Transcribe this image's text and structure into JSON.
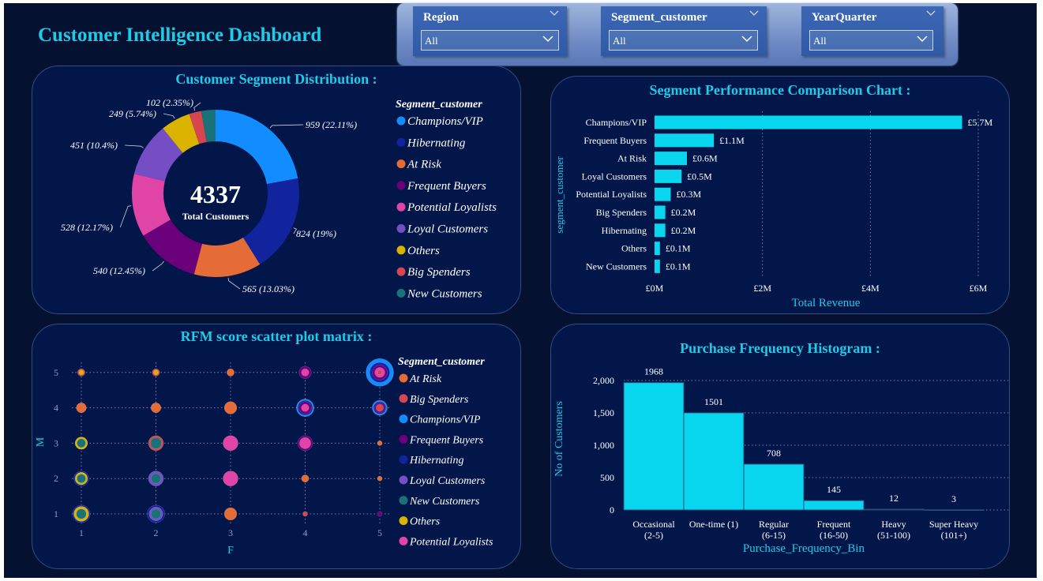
{
  "dashboard": {
    "title": "Customer Intelligence Dashboard"
  },
  "filters": [
    {
      "label": "Region",
      "value": "All"
    },
    {
      "label": "Segment_customer",
      "value": "All"
    },
    {
      "label": "YearQuarter",
      "value": "All"
    }
  ],
  "colors": {
    "Champions/VIP": "#118dff",
    "Hibernating": "#12239e",
    "At Risk": "#e66c37",
    "Frequent Buyers": "#6b007b",
    "Potential Loyalists": "#e044a7",
    "Loyal Customers": "#744ec2",
    "Others": "#d9b300",
    "Big Spenders": "#d64550",
    "New Customers": "#197278",
    "bars": "#08d6ee",
    "accent": "#1ecbe8"
  },
  "donut": {
    "title": "Customer Segment Distribution :",
    "center_value": "4337",
    "center_label": "Total Customers",
    "legend_title": "Segment_customer",
    "chart_data": {
      "type": "pie",
      "total": 4337,
      "slices": [
        {
          "name": "Champions/VIP",
          "value": 959,
          "label": "959 (22.11%)"
        },
        {
          "name": "Hibernating",
          "value": 824,
          "label": "824 (19%)"
        },
        {
          "name": "At Risk",
          "value": 565,
          "label": "565 (13.03%)"
        },
        {
          "name": "Frequent Buyers",
          "value": 540,
          "label": "540 (12.45%)"
        },
        {
          "name": "Potential Loyalists",
          "value": 528,
          "label": "528 (12.17%)"
        },
        {
          "name": "Loyal Customers",
          "value": 451,
          "label": "451 (10.4%)"
        },
        {
          "name": "Others",
          "value": 249,
          "label": "249 (5.74%)"
        },
        {
          "name": "Big Spenders",
          "value": 102,
          "label": "102 (2.35%)"
        },
        {
          "name": "New Customers",
          "value": 119,
          "label": ""
        }
      ]
    }
  },
  "bars": {
    "title": "Segment Performance Comparison Chart :",
    "chart_data": {
      "type": "bar",
      "orientation": "horizontal",
      "xlabel": "Total Revenue",
      "ylabel": "segment_customer",
      "xlim": [
        0,
        6
      ],
      "xticks": [
        0,
        2,
        4,
        6
      ],
      "xtick_labels": [
        "£0M",
        "£2M",
        "£4M",
        "£6M"
      ],
      "grid": true,
      "categories": [
        "Champions/VIP",
        "Frequent Buyers",
        "At Risk",
        "Loyal Customers",
        "Potential Loyalists",
        "Big Spenders",
        "Hibernating",
        "Others",
        "New Customers"
      ],
      "values": [
        5.7,
        1.1,
        0.6,
        0.5,
        0.3,
        0.2,
        0.2,
        0.1,
        0.1
      ],
      "data_labels": [
        "£5.7M",
        "£1.1M",
        "£0.6M",
        "£0.5M",
        "£0.3M",
        "£0.2M",
        "£0.2M",
        "£0.1M",
        "£0.1M"
      ]
    }
  },
  "scatter": {
    "title": "RFM score scatter plot matrix :",
    "legend_title": "Segment_customer",
    "legend": [
      "At Risk",
      "Big Spenders",
      "Champions/VIP",
      "Frequent Buyers",
      "Hibernating",
      "Loyal Customers",
      "New Customers",
      "Others",
      "Potential Loyalists"
    ],
    "chart_data": {
      "type": "scatter",
      "xlabel": "F",
      "ylabel": "M",
      "xlim": [
        1,
        5
      ],
      "ylim": [
        1,
        5
      ],
      "xticks": [
        1,
        2,
        3,
        4,
        5
      ],
      "yticks": [
        1,
        2,
        3,
        4,
        5
      ],
      "grid": true,
      "points": [
        {
          "f": 1,
          "m": 5,
          "layers": [
            {
              "segment": "Big Spenders",
              "size": 2
            },
            {
              "segment": "Others",
              "size": 1
            }
          ]
        },
        {
          "f": 2,
          "m": 5,
          "layers": [
            {
              "segment": "Big Spenders",
              "size": 2
            },
            {
              "segment": "Others",
              "size": 1
            }
          ]
        },
        {
          "f": 3,
          "m": 5,
          "layers": [
            {
              "segment": "At Risk",
              "size": 2
            }
          ]
        },
        {
          "f": 4,
          "m": 5,
          "layers": [
            {
              "segment": "Frequent Buyers",
              "size": 4
            },
            {
              "segment": "Potential Loyalists",
              "size": 2
            }
          ]
        },
        {
          "f": 5,
          "m": 5,
          "layers": [
            {
              "segment": "Champions/VIP",
              "size": 10
            },
            {
              "segment": "Hibernating",
              "size": 7
            },
            {
              "segment": "Frequent Buyers",
              "size": 5
            },
            {
              "segment": "Potential Loyalists",
              "size": 3
            },
            {
              "segment": "Big Spenders",
              "size": 1
            }
          ]
        },
        {
          "f": 1,
          "m": 4,
          "layers": [
            {
              "segment": "At Risk",
              "size": 3
            }
          ]
        },
        {
          "f": 2,
          "m": 4,
          "layers": [
            {
              "segment": "At Risk",
              "size": 3
            }
          ]
        },
        {
          "f": 3,
          "m": 4,
          "layers": [
            {
              "segment": "At Risk",
              "size": 4
            }
          ]
        },
        {
          "f": 4,
          "m": 4,
          "layers": [
            {
              "segment": "Champions/VIP",
              "size": 6
            },
            {
              "segment": "Hibernating",
              "size": 5
            },
            {
              "segment": "Frequent Buyers",
              "size": 4
            },
            {
              "segment": "Potential Loyalists",
              "size": 2
            }
          ]
        },
        {
          "f": 5,
          "m": 4,
          "layers": [
            {
              "segment": "Champions/VIP",
              "size": 5
            },
            {
              "segment": "Hibernating",
              "size": 4
            },
            {
              "segment": "Frequent Buyers",
              "size": 3
            },
            {
              "segment": "Big Spenders",
              "size": 2
            }
          ]
        },
        {
          "f": 1,
          "m": 3,
          "layers": [
            {
              "segment": "Others",
              "size": 4
            },
            {
              "segment": "New Customers",
              "size": 2.5
            }
          ]
        },
        {
          "f": 2,
          "m": 3,
          "layers": [
            {
              "segment": "Big Spenders",
              "size": 5
            },
            {
              "segment": "New Customers",
              "size": 3.5
            }
          ]
        },
        {
          "f": 3,
          "m": 3,
          "layers": [
            {
              "segment": "Potential Loyalists",
              "size": 5
            }
          ]
        },
        {
          "f": 4,
          "m": 3,
          "layers": [
            {
              "segment": "Frequent Buyers",
              "size": 5
            },
            {
              "segment": "Potential Loyalists",
              "size": 3.5
            }
          ]
        },
        {
          "f": 5,
          "m": 3,
          "layers": [
            {
              "segment": "At Risk",
              "size": 1
            }
          ]
        },
        {
          "f": 1,
          "m": 2,
          "layers": [
            {
              "segment": "Hibernating",
              "size": 5
            },
            {
              "segment": "Others",
              "size": 4
            },
            {
              "segment": "New Customers",
              "size": 2.5
            }
          ]
        },
        {
          "f": 2,
          "m": 2,
          "layers": [
            {
              "segment": "Loyal Customers",
              "size": 5
            },
            {
              "segment": "New Customers",
              "size": 3
            }
          ]
        },
        {
          "f": 3,
          "m": 2,
          "layers": [
            {
              "segment": "Potential Loyalists",
              "size": 5
            }
          ]
        },
        {
          "f": 4,
          "m": 2,
          "layers": [
            {
              "segment": "At Risk",
              "size": 2
            }
          ]
        },
        {
          "f": 5,
          "m": 2,
          "layers": [
            {
              "segment": "At Risk",
              "size": 1
            }
          ]
        },
        {
          "f": 1,
          "m": 1,
          "layers": [
            {
              "segment": "Hibernating",
              "size": 6
            },
            {
              "segment": "Others",
              "size": 5
            },
            {
              "segment": "New Customers",
              "size": 3
            }
          ]
        },
        {
          "f": 2,
          "m": 1,
          "layers": [
            {
              "segment": "Hibernating",
              "size": 6
            },
            {
              "segment": "Loyal Customers",
              "size": 4.5
            },
            {
              "segment": "New Customers",
              "size": 3
            }
          ]
        },
        {
          "f": 3,
          "m": 1,
          "layers": [
            {
              "segment": "At Risk",
              "size": 4
            }
          ]
        },
        {
          "f": 4,
          "m": 1,
          "layers": [
            {
              "segment": "Big Spenders",
              "size": 1
            }
          ]
        },
        {
          "f": 5,
          "m": 1,
          "layers": [
            {
              "segment": "Frequent Buyers",
              "size": 1
            }
          ]
        }
      ]
    }
  },
  "histogram": {
    "title": "Purchase Frequency Histogram :",
    "chart_data": {
      "type": "bar",
      "xlabel": "Purchase_Frequency_Bin",
      "ylabel": "No of Customers",
      "ylim": [
        0,
        2100
      ],
      "yticks": [
        0,
        500,
        1000,
        1500,
        2000
      ],
      "ytick_labels": [
        "0",
        "500",
        "1,000",
        "1,500",
        "2,000"
      ],
      "grid": true,
      "categories": [
        [
          "Occasional",
          "(2-5)"
        ],
        [
          "One-time (1)",
          ""
        ],
        [
          "Regular",
          "(6-15)"
        ],
        [
          "Frequent",
          "(16-50)"
        ],
        [
          "Heavy",
          "(51-100)"
        ],
        [
          "Super Heavy",
          "(101+)"
        ]
      ],
      "values": [
        1968,
        1501,
        708,
        145,
        12,
        3
      ],
      "data_labels": [
        "1968",
        "1501",
        "708",
        "145",
        "12",
        "3"
      ]
    }
  }
}
